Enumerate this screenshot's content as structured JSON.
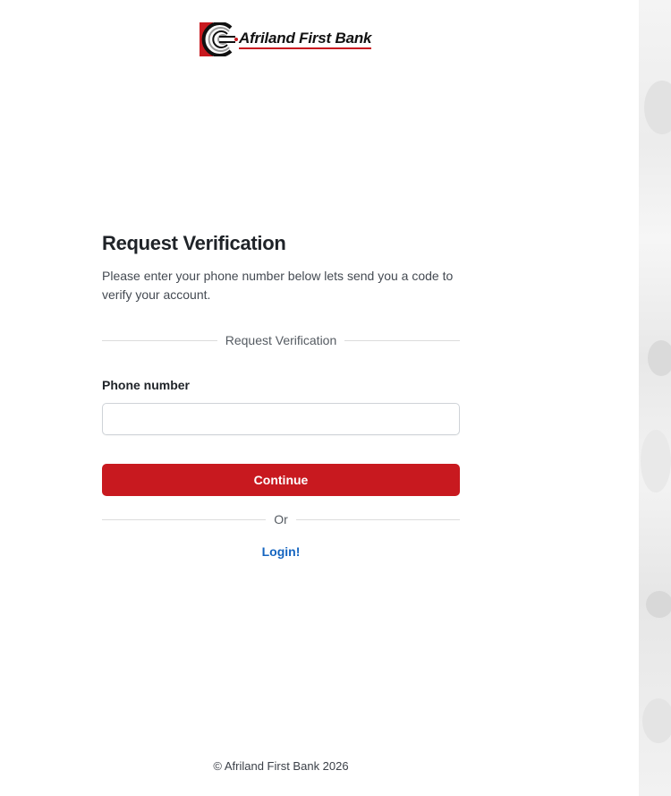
{
  "brand": {
    "name": "Afriland First Bank",
    "logo_icon": "afriland-logo-mark",
    "colors": {
      "accent": "#c8191f",
      "link": "#1565c0",
      "text": "#1f2328"
    }
  },
  "form": {
    "title": "Request Verification",
    "subtitle": "Please enter your phone number below lets send you a code to verify your account.",
    "section_divider_label": "Request Verification",
    "phone_label": "Phone number",
    "phone_value": "",
    "continue_label": "Continue",
    "or_label": "Or",
    "login_label": "Login!"
  },
  "footer": {
    "copyright": "© Afriland First Bank 2026"
  }
}
